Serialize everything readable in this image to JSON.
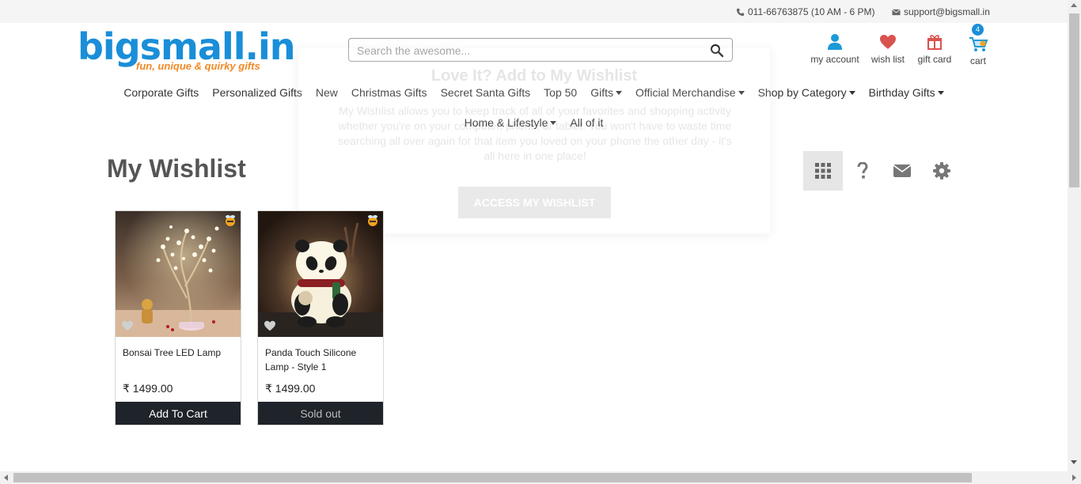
{
  "topbar": {
    "phone": "011-66763875 (10 AM - 6 PM)",
    "email": "support@bigsmall.in",
    "phone_icon": "phone-icon",
    "email_icon": "envelope-icon"
  },
  "logo": {
    "brand": "bigsmall.in",
    "tagline": "fun, unique & quirky gifts",
    "color": "#1a8ed8",
    "tagline_color": "#f08a24"
  },
  "search": {
    "placeholder": "Search the awesome...",
    "value": "",
    "icon": "search-icon"
  },
  "header_actions": {
    "account": {
      "label": "my account",
      "icon": "user-icon",
      "color": "#1a9ad6"
    },
    "wishlist": {
      "label": "wish list",
      "icon": "heart-icon",
      "color": "#d9534f"
    },
    "giftcard": {
      "label": "gift card",
      "icon": "gift-icon",
      "color": "#d9534f"
    },
    "cart": {
      "label": "cart",
      "icon": "cart-icon",
      "count": "4"
    }
  },
  "nav": {
    "row1": [
      {
        "label": "Corporate Gifts",
        "dropdown": false
      },
      {
        "label": "Personalized Gifts",
        "dropdown": false
      },
      {
        "label": "New",
        "dropdown": false
      },
      {
        "label": "Christmas Gifts",
        "dropdown": false
      },
      {
        "label": "Secret Santa Gifts",
        "dropdown": false
      },
      {
        "label": "Top 50",
        "dropdown": false
      },
      {
        "label": "Gifts",
        "dropdown": true
      },
      {
        "label": "Official Merchandise",
        "dropdown": true
      },
      {
        "label": "Shop by Category",
        "dropdown": true
      },
      {
        "label": "Birthday Gifts",
        "dropdown": true
      }
    ],
    "row2": [
      {
        "label": "Home & Lifestyle",
        "dropdown": true
      },
      {
        "label": "All of it",
        "dropdown": false
      }
    ]
  },
  "popup": {
    "title": "Love It? Add to My Wishlist",
    "text": "My Wishlist allows you to keep track of all of your favorites and shopping activity whether you're on your computer, phone, or tablet. You won't have to waste time searching all over again for that item you loved on your phone the other day - it's all here in one place!",
    "button": "ACCESS MY WISHLIST"
  },
  "page": {
    "title": "My Wishlist",
    "tools": [
      {
        "name": "grid-icon",
        "active": true
      },
      {
        "name": "help-icon",
        "active": false
      },
      {
        "name": "envelope-icon",
        "active": false
      },
      {
        "name": "gear-icon",
        "active": false
      }
    ]
  },
  "products": [
    {
      "name": "Bonsai Tree LED Lamp",
      "price": "₹ 1499.00",
      "action": "Add To Cart",
      "sold_out": false
    },
    {
      "name": "Panda Touch Silicone Lamp - Style 1",
      "price": "₹ 1499.00",
      "action": "Sold out",
      "sold_out": true
    }
  ]
}
